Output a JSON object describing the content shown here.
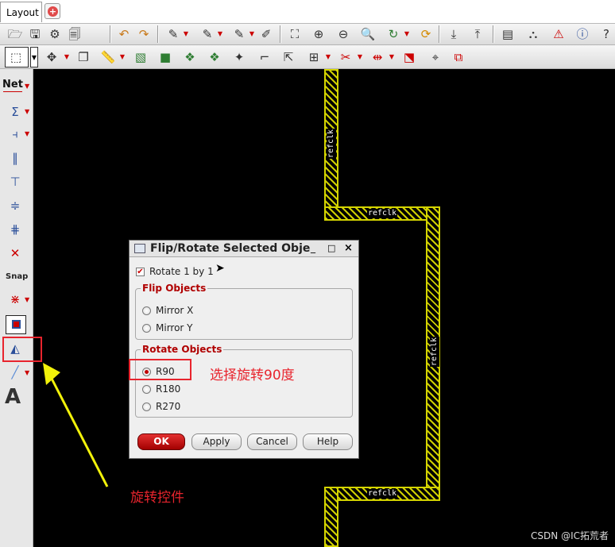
{
  "tab": {
    "label": "Layout",
    "add_label": "+"
  },
  "left_toolbar": {
    "net_label": "Net",
    "snap_label": "Snap",
    "text_tool_label": "A"
  },
  "canvas": {
    "wire_labels": [
      "refclk",
      "refclk",
      "refclk",
      "refclk"
    ]
  },
  "dialog": {
    "title": "Flip/Rotate Selected Obje",
    "rotate_checkbox_label": "Rotate 1 by 1",
    "flip_group": {
      "title": "Flip Objects",
      "options": [
        "Mirror X",
        "Mirror Y"
      ]
    },
    "rotate_group": {
      "title": "Rotate Objects",
      "options": [
        "R90",
        "R180",
        "R270"
      ],
      "selected": "R90"
    },
    "buttons": {
      "ok": "OK",
      "apply": "Apply",
      "cancel": "Cancel",
      "help": "Help"
    }
  },
  "annotations": {
    "rotate_hint": "选择旋转90度",
    "control_hint": "旋转控件"
  },
  "watermark": "CSDN @IC拓荒者",
  "colors": {
    "highlight": "#e8242d",
    "wire": "#d4d400",
    "dialog_accent": "#b00000"
  }
}
